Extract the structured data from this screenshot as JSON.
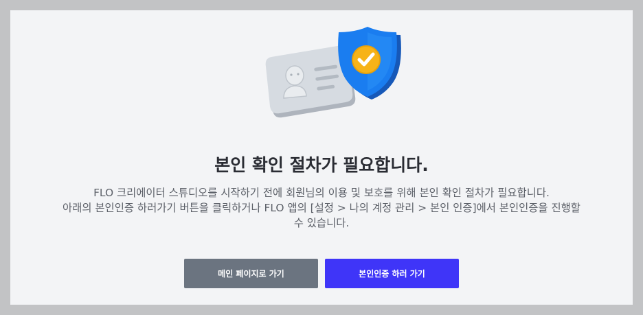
{
  "dialog": {
    "title": "본인 확인 절차가 필요합니다.",
    "description_line1": "FLO 크리에이터 스튜디오를 시작하기 전에 회원님의 이용 및 보호를 위해 본인 확인 절차가 필요합니다.",
    "description_line2": "아래의 본인인증 하러가기 버튼을 클릭하거나 FLO 앱의 [설정 > 나의 계정 관리 > 본인 인증]에서 본인인증을 진행할",
    "description_line3": "수 있습니다.",
    "illustration_icon": "id-card-with-shield-check-icon"
  },
  "buttons": {
    "main_page_label": "메인 페이지로 가기",
    "verify_label": "본인인증 하러 가기"
  },
  "colors": {
    "overlay": "#c2c3c5",
    "dialog_bg": "#f3f4f6",
    "primary_button": "#3f35f8",
    "secondary_button": "#6b7480",
    "shield": "#1a7df0",
    "check_badge": "#f7b318"
  }
}
